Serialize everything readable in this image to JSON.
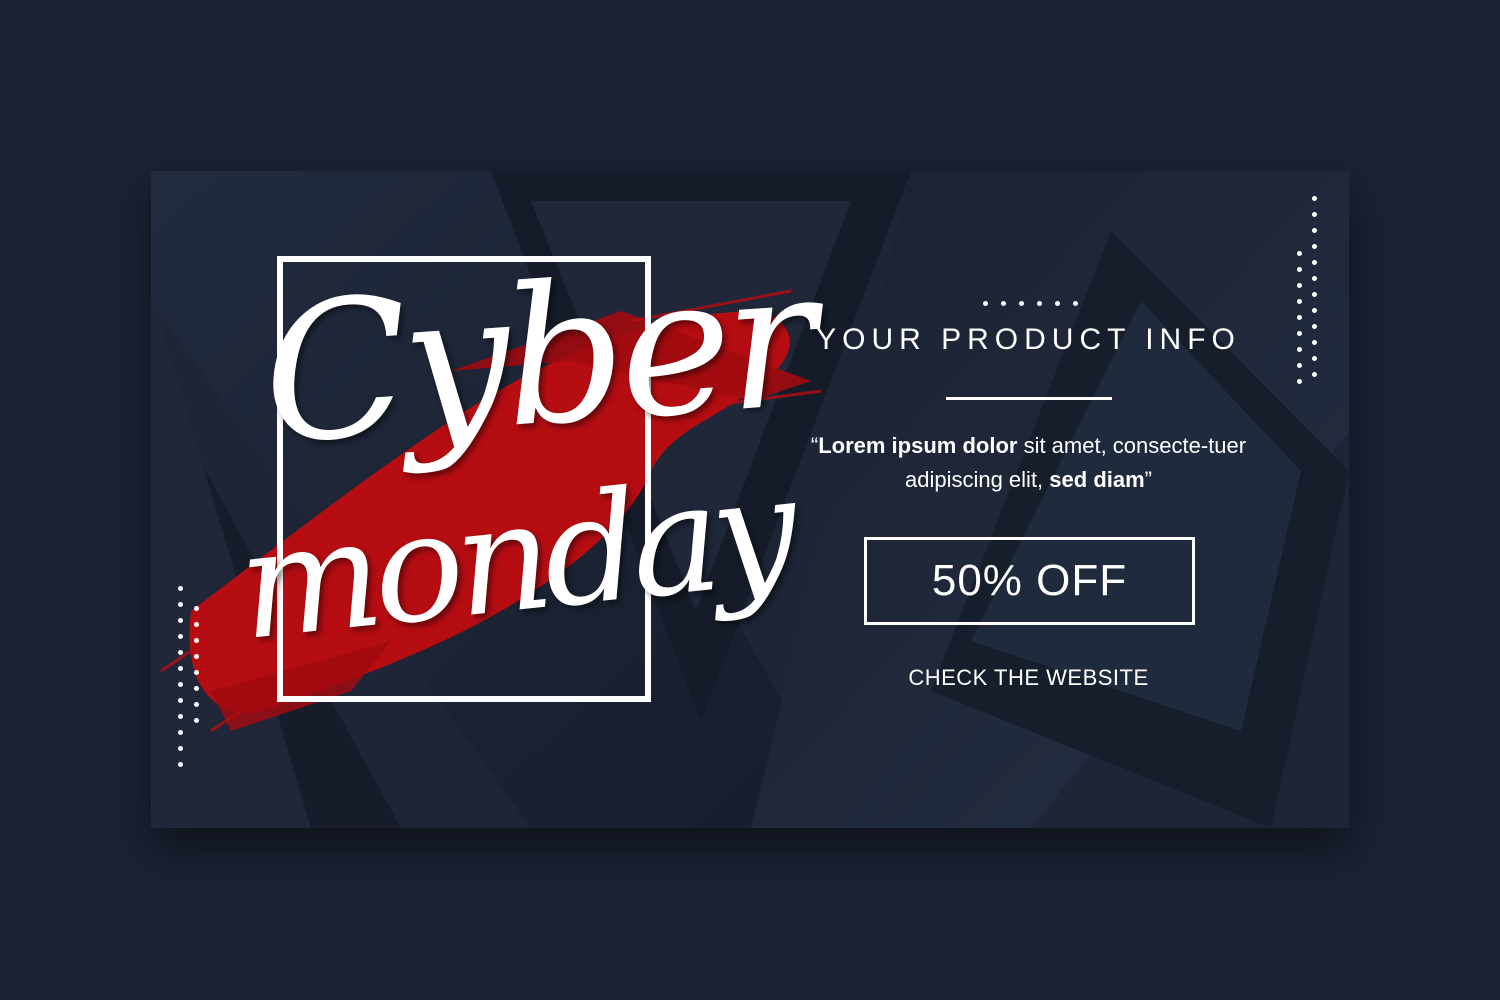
{
  "headline": {
    "line1": "Cyber",
    "line2": "monday"
  },
  "info": {
    "title": "YOUR PRODUCT INFO",
    "quote_open": "“",
    "quote_bold_1": "Lorem ipsum dolor",
    "quote_regular_1": " sit amet, consecte-tuer adipiscing elit, ",
    "quote_bold_2": "sed diam",
    "quote_close": "”"
  },
  "offer": {
    "label": "50% OFF"
  },
  "cta": {
    "label": "CHECK THE WEBSITE"
  },
  "colors": {
    "page_background": "#1b2233",
    "banner_background": "#1c2435",
    "brush_red": "#b50d12",
    "text": "#ffffff"
  }
}
